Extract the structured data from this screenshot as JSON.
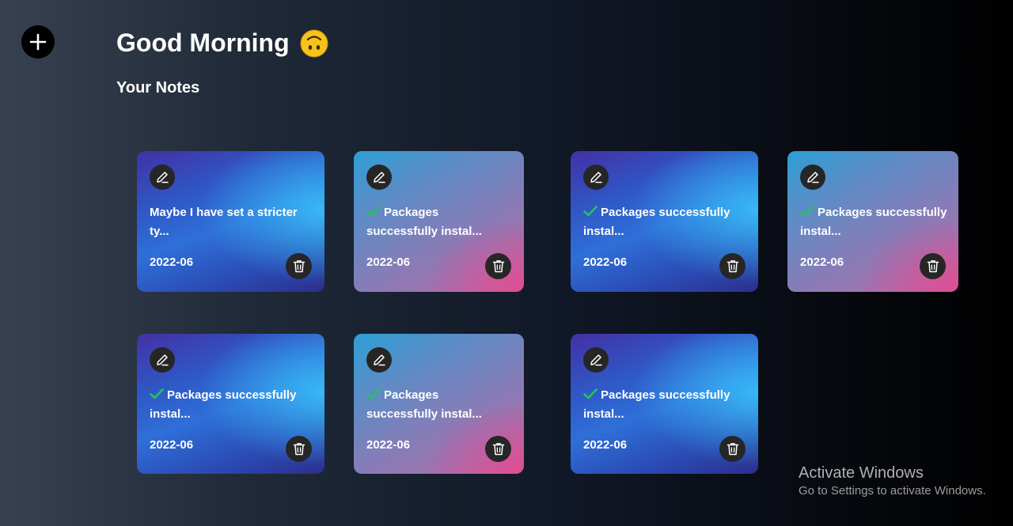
{
  "header": {
    "greeting": "Good Morning",
    "greeting_emoji": "upside-down-face-emoji",
    "section_title": "Your Notes"
  },
  "add_button": {
    "icon": "plus-icon"
  },
  "notes": [
    {
      "text": "Maybe I have set a stricter ty...",
      "date": "2022-06",
      "checked": false,
      "style": "blue"
    },
    {
      "text": "Packages successfully instal...",
      "date": "2022-06",
      "checked": true,
      "style": "pink"
    },
    {
      "text": "Packages successfully instal...",
      "date": "2022-06",
      "checked": true,
      "style": "blue"
    },
    {
      "text": "Packages successfully instal...",
      "date": "2022-06",
      "checked": true,
      "style": "pink"
    },
    {
      "text": "Packages successfully instal...",
      "date": "2022-06",
      "checked": true,
      "style": "blue"
    },
    {
      "text": "Packages successfully instal...",
      "date": "2022-06",
      "checked": true,
      "style": "pink"
    },
    {
      "text": "Packages successfully instal...",
      "date": "2022-06",
      "checked": true,
      "style": "blue"
    }
  ],
  "watermark": {
    "title": "Activate Windows",
    "subtitle": "Go to Settings to activate Windows."
  },
  "colors": {
    "check": "#22c55e",
    "button_bg": "#262626",
    "emoji_face": "#f6c21c"
  }
}
